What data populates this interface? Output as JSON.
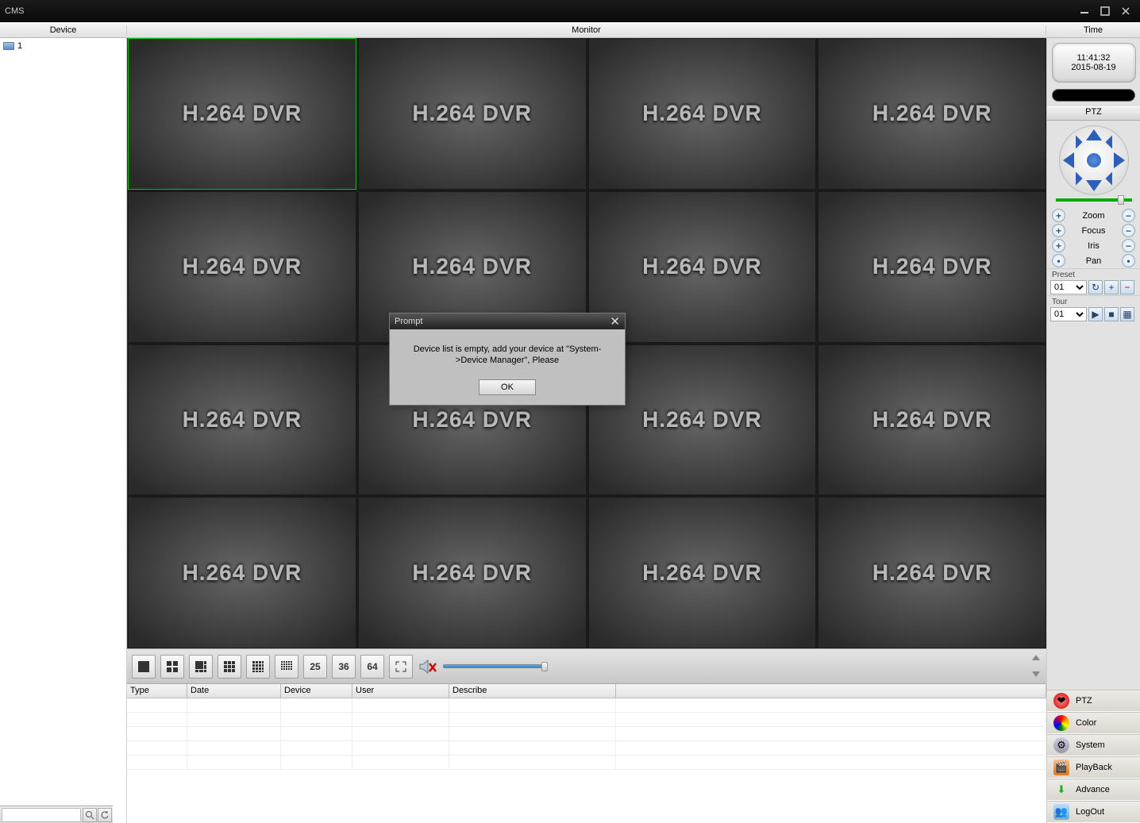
{
  "app": {
    "title": "CMS"
  },
  "header": {
    "device": "Device",
    "monitor": "Monitor",
    "time": "Time"
  },
  "tree": {
    "items": [
      {
        "label": "1"
      }
    ]
  },
  "clock": {
    "time": "11:41:32",
    "date": "2015-08-19"
  },
  "ptz": {
    "header": "PTZ",
    "zoom": "Zoom",
    "focus": "Focus",
    "iris": "Iris",
    "pan": "Pan",
    "preset_label": "Preset",
    "preset_value": "01",
    "tour_label": "Tour",
    "tour_value": "01"
  },
  "rightmenu": {
    "ptz": "PTZ",
    "color": "Color",
    "system": "System",
    "playback": "PlayBack",
    "advance": "Advance",
    "logout": "LogOut"
  },
  "toolbar": {
    "b25": "25",
    "b36": "36",
    "b64": "64"
  },
  "tiles": {
    "watermark": "H.264 DVR"
  },
  "log": {
    "headers": {
      "type": "Type",
      "date": "Date",
      "device": "Device",
      "user": "User",
      "describe": "Describe"
    }
  },
  "dialog": {
    "title": "Prompt",
    "body": "Device list is empty, add your device at \"System->Device Manager\", Please",
    "ok": "OK"
  }
}
